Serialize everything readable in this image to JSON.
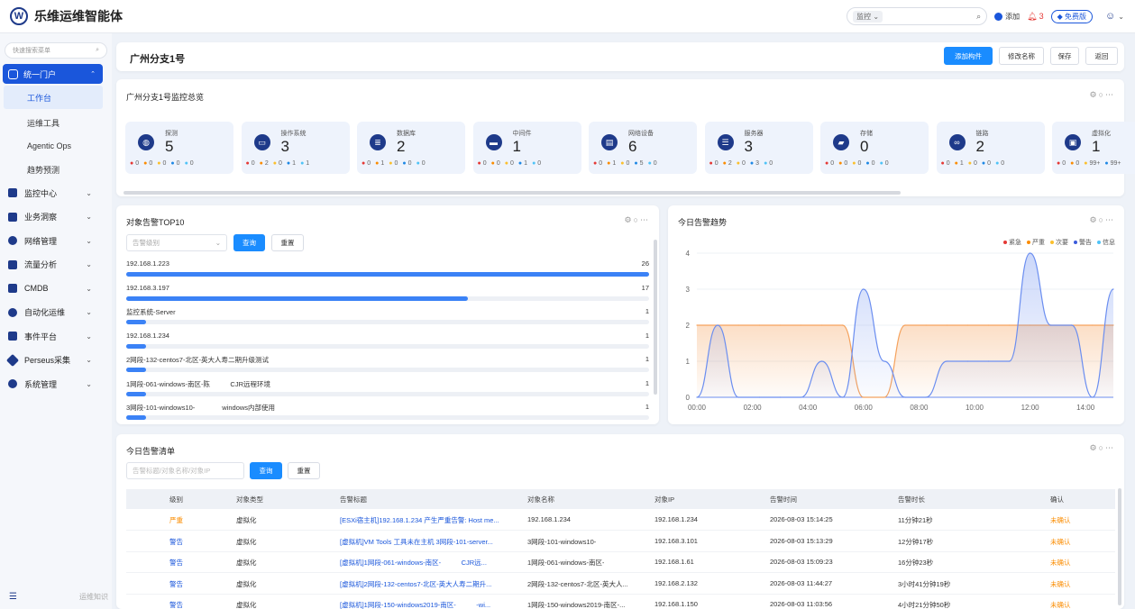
{
  "app": {
    "title": "乐维运维智能体",
    "logo_letter": "W"
  },
  "topbar": {
    "search_scope": "监控",
    "add_label": "添加",
    "alarm_count": "3",
    "free_label": "免费版"
  },
  "sidebar": {
    "search_placeholder": "快速搜索菜单",
    "top_item": "统一门户",
    "sub_items": [
      "工作台",
      "运维工具",
      "Agentic Ops",
      "趋势预测"
    ],
    "items": [
      "监控中心",
      "业务洞察",
      "网络管理",
      "流量分析",
      "CMDB",
      "自动化运维",
      "事件平台",
      "Perseus采集",
      "系统管理"
    ],
    "bottom_label": "运维知识"
  },
  "header": {
    "title": "广州分支1号",
    "buttons": [
      "添加构件",
      "修改名称",
      "保存",
      "返回"
    ]
  },
  "overview": {
    "title": "广州分支1号监控总览",
    "metrics": [
      {
        "label": "探测",
        "value": "5",
        "dots": [
          "0",
          "0",
          "0",
          "0",
          "0"
        ],
        "icon": "globe-icon"
      },
      {
        "label": "操作系统",
        "value": "3",
        "dots": [
          "0",
          "2",
          "0",
          "1",
          "1"
        ],
        "icon": "monitor-icon"
      },
      {
        "label": "数据库",
        "value": "2",
        "dots": [
          "0",
          "1",
          "0",
          "0",
          "0"
        ],
        "icon": "database-icon"
      },
      {
        "label": "中间件",
        "value": "1",
        "dots": [
          "0",
          "0",
          "0",
          "1",
          "0"
        ],
        "icon": "desktop-icon"
      },
      {
        "label": "网络设备",
        "value": "6",
        "dots": [
          "0",
          "1",
          "0",
          "5",
          "0"
        ],
        "icon": "router-icon"
      },
      {
        "label": "服务器",
        "value": "3",
        "dots": [
          "0",
          "2",
          "0",
          "3",
          "0"
        ],
        "icon": "server-icon"
      },
      {
        "label": "存储",
        "value": "0",
        "dots": [
          "0",
          "0",
          "0",
          "0",
          "0"
        ],
        "icon": "storage-icon"
      },
      {
        "label": "链路",
        "value": "2",
        "dots": [
          "0",
          "1",
          "0",
          "0",
          "0"
        ],
        "icon": "link-icon"
      },
      {
        "label": "虚拟化",
        "value": "1",
        "dots": [
          "0",
          "0",
          "99+",
          "99+"
        ],
        "icon": "virtual-icon"
      }
    ],
    "dot_colors": [
      "#e53935",
      "#fb8c00",
      "#fbc02d",
      "#1e88e5",
      "#4fc3f7"
    ]
  },
  "top10": {
    "title": "对象告警TOP10",
    "select_placeholder": "告警级别",
    "query_label": "查询",
    "reset_label": "重置",
    "rows": [
      {
        "name": "192.168.1.223",
        "count": 26
      },
      {
        "name": "192.168.3.197",
        "count": 17
      },
      {
        "name": "监控系统-Server",
        "count": 1
      },
      {
        "name": "192.168.1.234",
        "count": 1
      },
      {
        "name": "2网段-132-centos7-北区-英大人寿二期升级测试",
        "count": 1
      },
      {
        "name": "1网段-061-windows-南区-陈　　　CJR远程环境",
        "count": 1
      },
      {
        "name": "3网段-101-windows10-　　　　windows内部使用",
        "count": 1
      }
    ]
  },
  "trend": {
    "title": "今日告警趋势",
    "legend": [
      {
        "name": "紧急",
        "color": "#e53935"
      },
      {
        "name": "严重",
        "color": "#fb8c00"
      },
      {
        "name": "次要",
        "color": "#fbc02d"
      },
      {
        "name": "警告",
        "color": "#3b5bdb"
      },
      {
        "name": "信息",
        "color": "#4fc3f7"
      }
    ]
  },
  "chart_data": {
    "type": "line",
    "x": [
      "00:00",
      "00:45",
      "01:30",
      "02:15",
      "03:00",
      "03:45",
      "04:30",
      "05:15",
      "06:00",
      "06:45",
      "07:30",
      "08:15",
      "09:00",
      "09:45",
      "10:30",
      "11:15",
      "12:00",
      "12:45",
      "13:30",
      "14:15",
      "15:00"
    ],
    "xticks": [
      "00:00",
      "02:00",
      "04:00",
      "06:00",
      "08:00",
      "10:00",
      "12:00",
      "14:00"
    ],
    "yticks": [
      "0",
      "1",
      "2",
      "3",
      "4"
    ],
    "ylim": [
      0,
      4
    ],
    "series": [
      {
        "name": "严重",
        "color": "#f5a25d",
        "values": [
          2,
          2,
          2,
          2,
          2,
          2,
          2,
          2,
          0,
          0,
          2,
          2,
          2,
          2,
          2,
          2,
          2,
          2,
          2,
          2,
          2
        ]
      },
      {
        "name": "警告",
        "color": "#6b8ef0",
        "values": [
          0,
          2,
          0,
          0,
          0,
          0,
          1,
          0,
          3,
          1,
          0,
          0,
          1,
          1,
          1,
          1,
          4,
          2,
          2,
          0,
          3
        ]
      }
    ]
  },
  "alarm_list": {
    "title": "今日告警清单",
    "search_placeholder": "告警标题/对象名称/对象IP",
    "query_label": "查询",
    "reset_label": "重置",
    "columns": [
      "级别",
      "对象类型",
      "告警标题",
      "对象名称",
      "对象IP",
      "告警时间",
      "告警时长",
      "确认"
    ],
    "rows": [
      {
        "level": "严重",
        "level_color": "#fb8c00",
        "type": "虚拟化",
        "title": "[ESXi宿主机]192.168.1.234 产生严重告警: Host me...",
        "obj": "192.168.1.234",
        "ip": "192.168.1.234",
        "time": "2026-08-03 15:14:25",
        "dur": "11分钟21秒",
        "ack": "未确认"
      },
      {
        "level": "警告",
        "level_color": "#1a56db",
        "type": "虚拟化",
        "title": "[虚拟机]VM Tools 工具未在主机 3网段-101-server...",
        "obj": "3网段-101-windows10-",
        "ip": "192.168.3.101",
        "time": "2026-08-03 15:13:29",
        "dur": "12分钟17秒",
        "ack": "未确认"
      },
      {
        "level": "警告",
        "level_color": "#1a56db",
        "type": "虚拟化",
        "title": "[虚拟机]1网段-061-windows-南区-　　　CJR远...",
        "obj": "1网段-061-windows-南区-",
        "ip": "192.168.1.61",
        "time": "2026-08-03 15:09:23",
        "dur": "16分钟23秒",
        "ack": "未确认"
      },
      {
        "level": "警告",
        "level_color": "#1a56db",
        "type": "虚拟化",
        "title": "[虚拟机]2网段-132-centos7-北区-英大人寿二期升...",
        "obj": "2网段-132-centos7-北区-英大人...",
        "ip": "192.168.2.132",
        "time": "2026-08-03 11:44:27",
        "dur": "3小时41分钟19秒",
        "ack": "未确认"
      },
      {
        "level": "警告",
        "level_color": "#1a56db",
        "type": "虚拟化",
        "title": "[虚拟机]1网段-150-windows2019-南区-　　　-wi...",
        "obj": "1网段-150-windows2019-南区-...",
        "ip": "192.168.1.150",
        "time": "2026-08-03 11:03:56",
        "dur": "4小时21分钟50秒",
        "ack": "未确认"
      }
    ]
  }
}
